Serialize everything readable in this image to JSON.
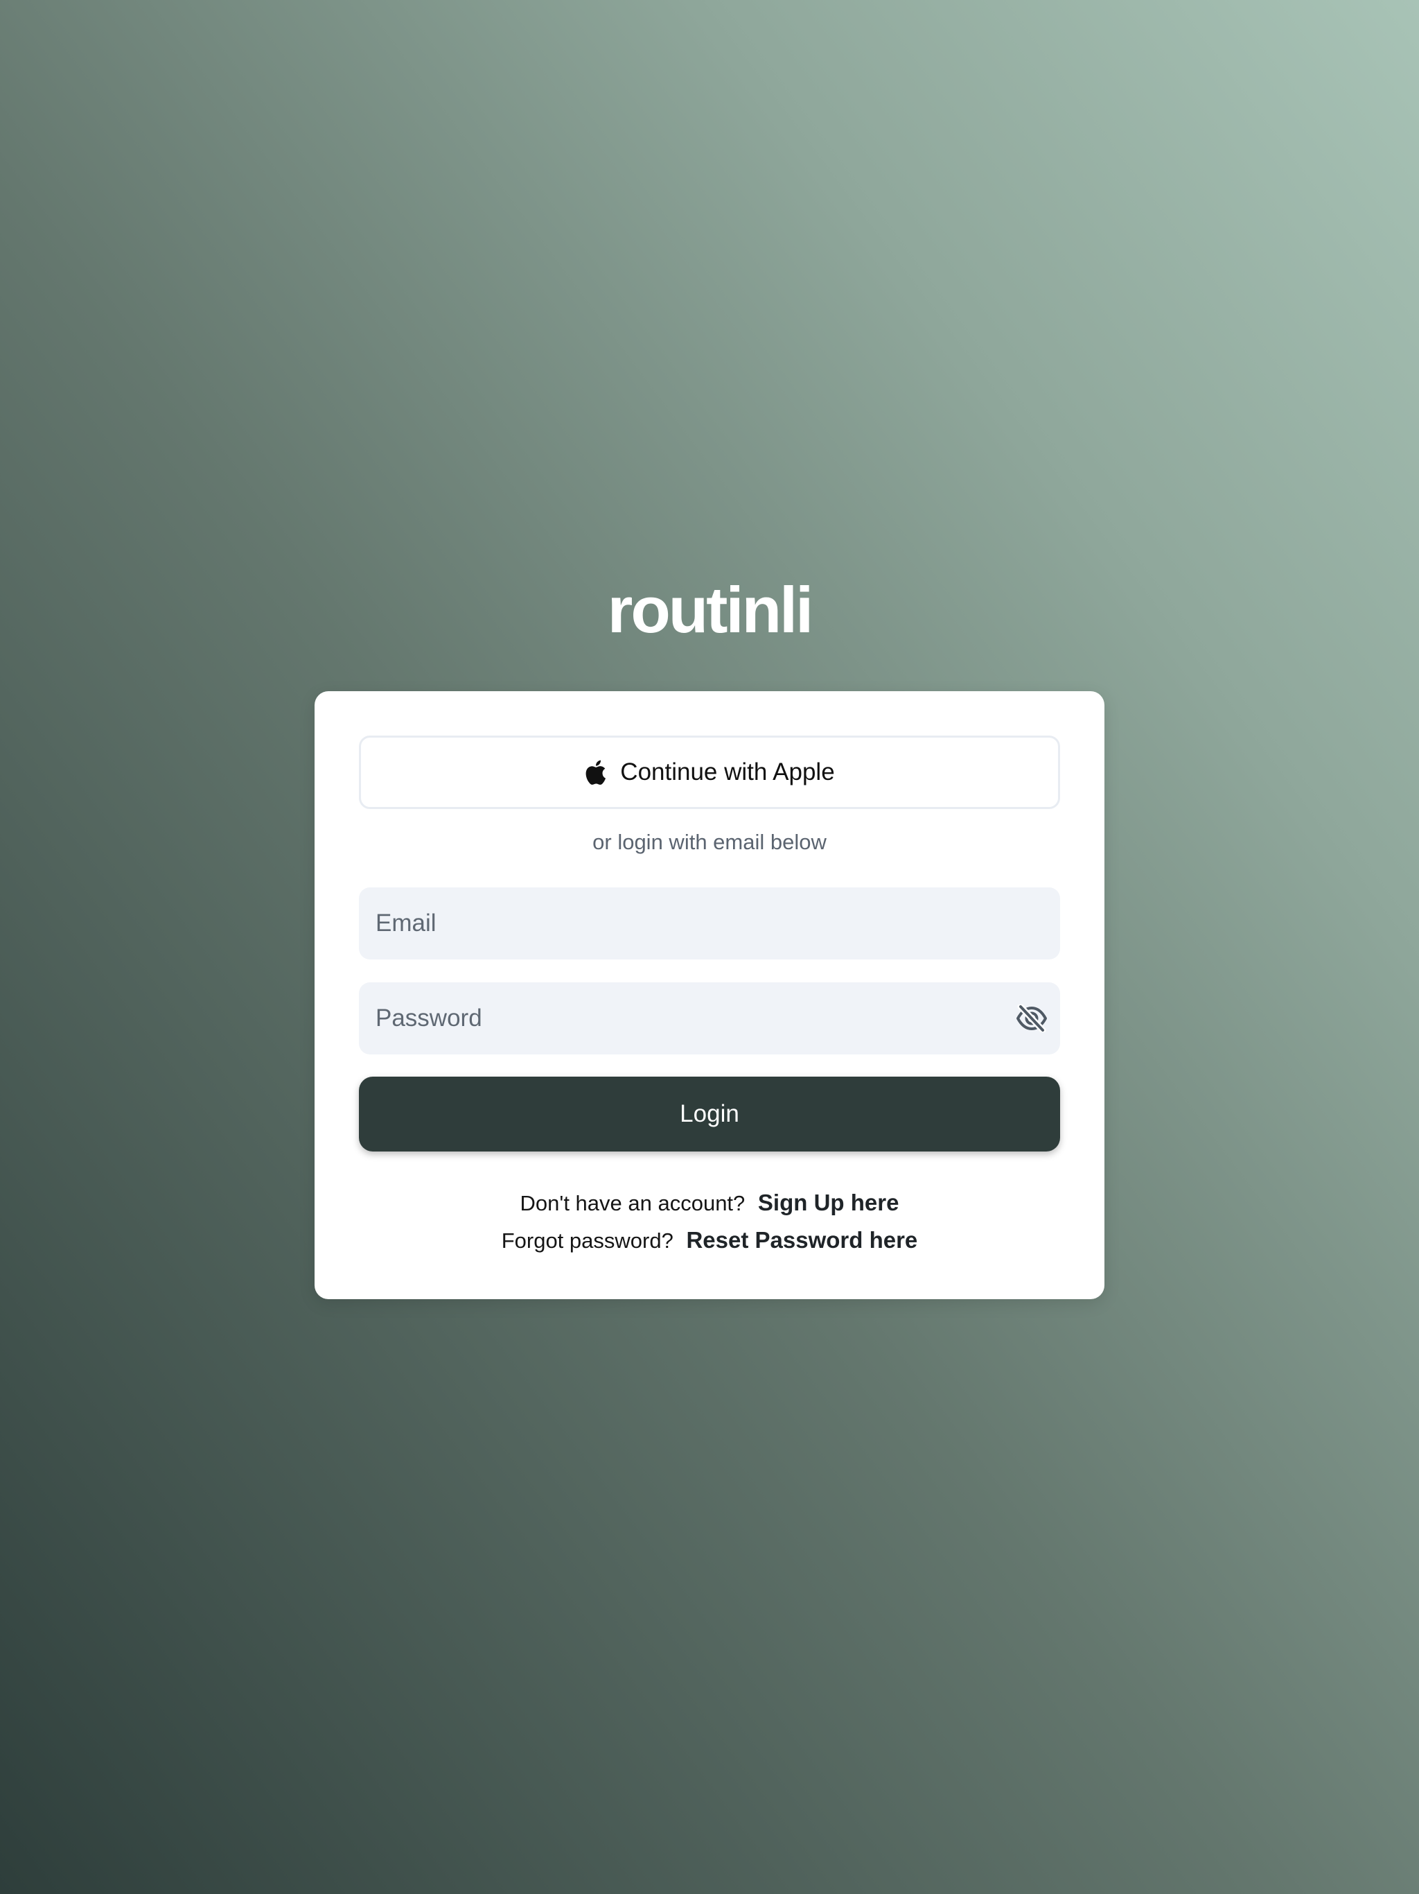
{
  "brand": {
    "name": "routinli"
  },
  "card": {
    "apple_button": {
      "label": "Continue with Apple",
      "icon": "apple-icon"
    },
    "divider_text": "or login with email below",
    "email": {
      "placeholder": "Email",
      "value": ""
    },
    "password": {
      "placeholder": "Password",
      "value": "",
      "toggle_icon": "eye-off-icon"
    },
    "login_button": {
      "label": "Login"
    },
    "signup": {
      "prompt": "Don't have an account?",
      "link": "Sign Up here"
    },
    "reset": {
      "prompt": "Forgot password?",
      "link": "Reset Password here"
    }
  },
  "colors": {
    "primary_button": "#2f3d3b",
    "input_background": "#f0f3f8",
    "background_dark": "#2e3e3b",
    "background_light": "#a8c3b6"
  }
}
